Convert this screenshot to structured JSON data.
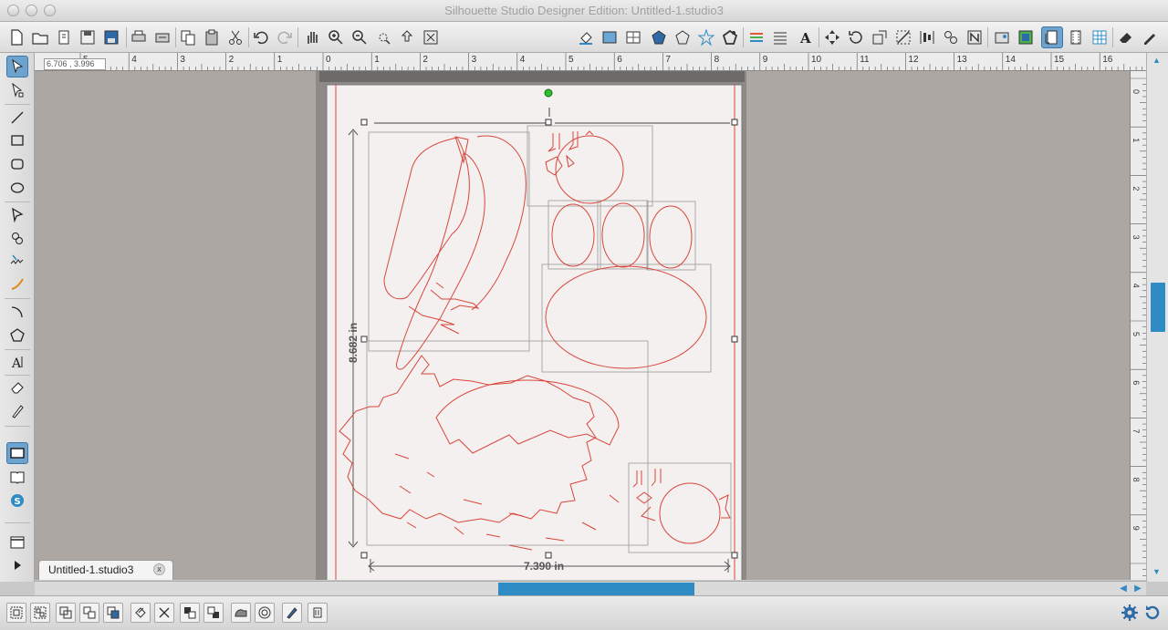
{
  "window": {
    "title": "Silhouette Studio Designer Edition: Untitled-1.studio3"
  },
  "toolbar": {
    "left_icons": [
      "new-document-icon",
      "open-icon",
      "library-icon",
      "save-icon",
      "save-to-library-icon",
      "print-icon",
      "print-cut-icon",
      "copy-icon",
      "paste-icon",
      "cut-icon",
      "undo-icon",
      "redo-icon",
      "pan-hand-icon",
      "zoom-in-icon",
      "zoom-out-icon",
      "zoom-selection-icon",
      "drag-zoom-icon",
      "fit-to-page-icon"
    ],
    "right_icons": [
      "fill-color-icon",
      "fill-gradient-icon",
      "fill-pattern-icon",
      "line-color-icon",
      "line-style-icon",
      "shadow-icon",
      "line-width-icon",
      "dashed-line-icon",
      "text-style-icon",
      "transform-icon",
      "rotate-icon",
      "scale-icon",
      "move-icon",
      "align-icon",
      "replicate-icon",
      "nesting-icon",
      "trace-icon",
      "offset-icon",
      "design-page-icon",
      "cut-settings-icon",
      "grid-settings-icon",
      "eraser-icon",
      "send-to-silhouette-icon"
    ]
  },
  "coordinates": {
    "readout": "6.706 , 3.996"
  },
  "ruler": {
    "horizontal_labels": [
      "5",
      "4",
      "3",
      "2",
      "1",
      "0",
      "1",
      "2",
      "3",
      "4",
      "5",
      "6",
      "7",
      "8",
      "9",
      "10",
      "11",
      "12",
      "13",
      "14",
      "15",
      "16"
    ],
    "vertical_labels": [
      "0",
      "1",
      "2",
      "3",
      "4",
      "5",
      "6",
      "7",
      "8",
      "9"
    ]
  },
  "dimensions": {
    "height": "8.682 in",
    "width": "7.390 in"
  },
  "left_tools": [
    "select-tool-icon",
    "point-edit-tool-icon",
    "line-tool-icon",
    "rectangle-tool-icon",
    "rounded-rectangle-tool-icon",
    "ellipse-tool-icon",
    "polygon-tool-icon",
    "curve-tool-icon",
    "freehand-tool-icon",
    "smooth-freehand-tool-icon",
    "arc-tool-icon",
    "regular-polygon-tool-icon",
    "text-tool-icon",
    "eraser-tool-icon",
    "knife-tool-icon",
    "design-area-icon",
    "library-view-icon",
    "silhouette-store-icon",
    "show-cut-icon",
    "play-icon"
  ],
  "tabs": [
    {
      "label": "Untitled-1.studio3",
      "close": "x"
    }
  ],
  "bottom_toolbar": {
    "icons": [
      "group-icon",
      "ungroup-icon",
      "make-compound-path-icon",
      "release-compound-path-icon",
      "bring-to-front-icon",
      "duplicate-icon",
      "delete-icon",
      "bring-forward-icon",
      "send-backward-icon",
      "weld-icon",
      "offset-icon-small",
      "knife-icon",
      "send-to-back-icon"
    ],
    "right_icons": [
      "settings-gear-icon",
      "refresh-icon"
    ]
  },
  "colors": {
    "accent": "#2f8bc4",
    "cut_line": "#d9463b",
    "canvas": "#ada7a4",
    "page": "#f3f0ef"
  }
}
